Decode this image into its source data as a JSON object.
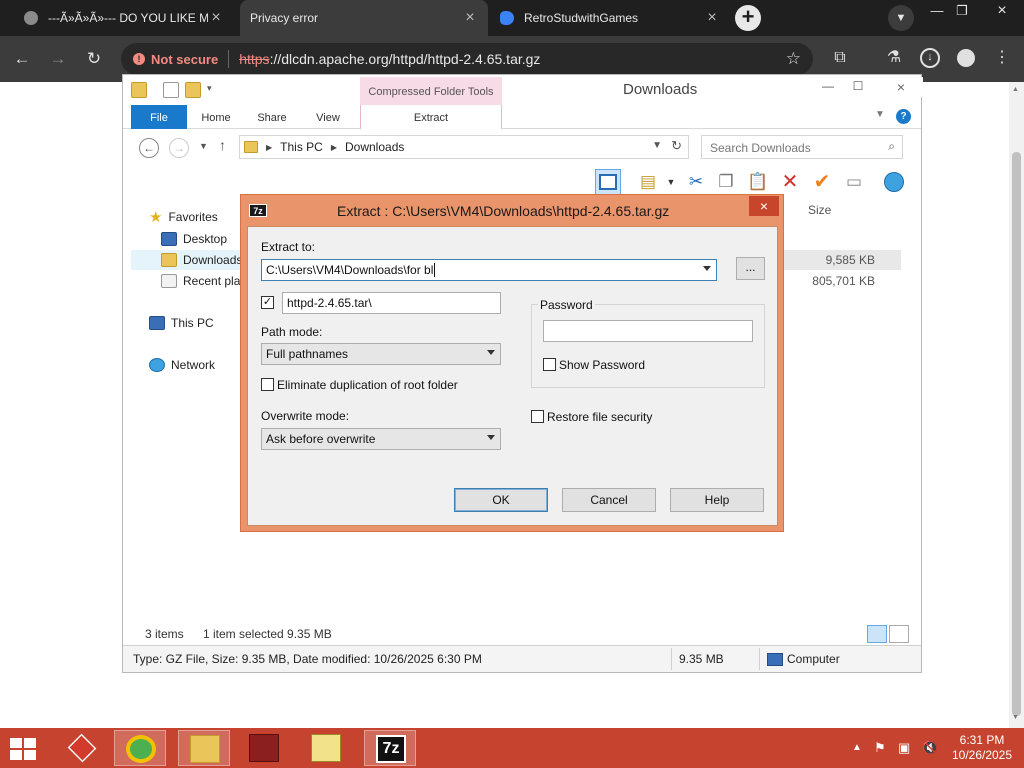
{
  "browser": {
    "tabs": [
      {
        "title": "---Ã»Ã»Ã»--- DO YOU LIKE MO",
        "active": false
      },
      {
        "title": "Privacy error",
        "active": true
      },
      {
        "title": "RetroStudwithGames",
        "active": false
      }
    ],
    "security_label": "Not secure",
    "url_scheme": "https",
    "url_rest": "://dlcdn.apache.org/httpd/httpd-2.4.65.tar.gz"
  },
  "explorer": {
    "title": "Downloads",
    "context_tab": "Compressed Folder Tools",
    "ribbon_tabs": [
      "File",
      "Home",
      "Share",
      "View",
      "Extract"
    ],
    "breadcrumb": [
      "This PC",
      "Downloads"
    ],
    "search_placeholder": "Search Downloads",
    "column_size": "Size",
    "nav": {
      "favorites": "Favorites",
      "desktop": "Desktop",
      "downloads": "Downloads",
      "recent": "Recent plac",
      "this_pc": "This PC",
      "network": "Network"
    },
    "sizes": [
      "9,585 KB",
      "805,701 KB"
    ],
    "status": {
      "items": "3 items",
      "selected": "1 item selected  9.35 MB",
      "details": "Type: GZ File, Size: 9.35 MB, Date modified: 10/26/2025 6:30 PM",
      "size": "9.35 MB",
      "location": "Computer"
    }
  },
  "dialog": {
    "title": "Extract : C:\\Users\\VM4\\Downloads\\httpd-2.4.65.tar.gz",
    "extract_to_label": "Extract to:",
    "extract_to_value": "C:\\Users\\VM4\\Downloads\\for bl",
    "browse_label": "...",
    "subfolder_value": "httpd-2.4.65.tar\\",
    "path_mode_label": "Path mode:",
    "path_mode_value": "Full pathnames",
    "eliminate_label": "Eliminate duplication of root folder",
    "overwrite_label": "Overwrite mode:",
    "overwrite_value": "Ask before overwrite",
    "password_label": "Password",
    "show_password_label": "Show Password",
    "restore_security_label": "Restore file security",
    "ok_label": "OK",
    "cancel_label": "Cancel",
    "help_label": "Help"
  },
  "taskbar": {
    "time": "6:31 PM",
    "date": "10/26/2025",
    "seven_zip_label": "7z"
  },
  "colors": {
    "taskbar": "#c5432f",
    "dialog_frame": "#e9946a",
    "file_tab": "#1979ca",
    "context_tab": "#f7dbe7"
  }
}
